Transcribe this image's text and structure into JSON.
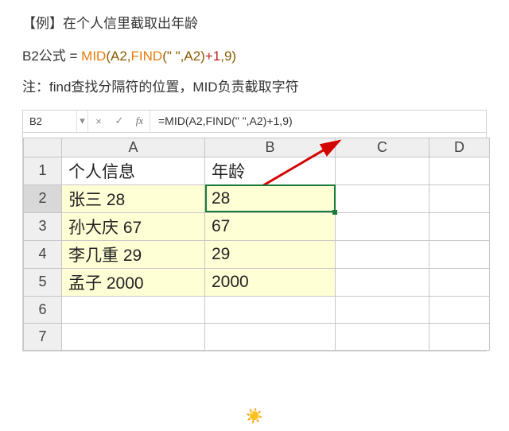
{
  "intro": "【例】在个人信里截取出年龄",
  "formula_line": {
    "prefix": "B2公式",
    "eq": " = ",
    "parts": [
      "MID",
      "(A2,",
      "FIND",
      "(\" \",A2)",
      "+1",
      ",9)"
    ]
  },
  "note": "注：find查找分隔符的位置，MID负责截取字符",
  "excel": {
    "namebox": "B2",
    "fx_label": "fx",
    "cancel_icon": "×",
    "enter_icon": "✓",
    "dropdown_icon": "▾",
    "formula": "=MID(A2,FIND(\" \",A2)+1,9)",
    "columns": [
      "A",
      "B",
      "C",
      "D"
    ],
    "row_numbers": [
      "1",
      "2",
      "3",
      "4",
      "5",
      "6",
      "7"
    ],
    "active_row": 2,
    "headers": {
      "A": "个人信息",
      "B": "年龄"
    },
    "rows": [
      {
        "A": "张三 28",
        "B": "28"
      },
      {
        "A": "孙大庆 67",
        "B": "67"
      },
      {
        "A": "李几重 29",
        "B": "29"
      },
      {
        "A": "孟子 2000",
        "B": "2000"
      }
    ],
    "selected_cell": "B2"
  },
  "decoration": "☀️"
}
